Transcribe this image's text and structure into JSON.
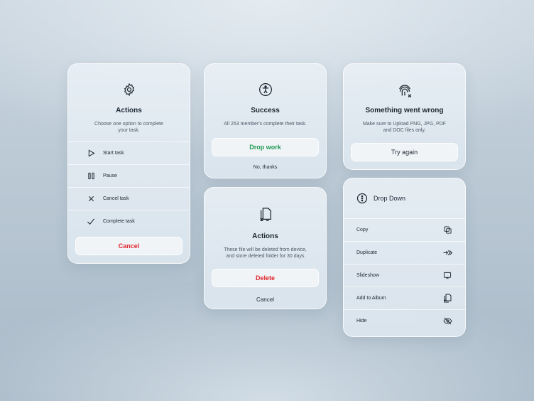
{
  "card_actions": {
    "icon": "gear-icon",
    "title": "Actions",
    "description_line1": "Choose one option to complete",
    "description_line2": "your task.",
    "items": [
      {
        "label": "Start task",
        "icon": "play-icon"
      },
      {
        "label": "Pause",
        "icon": "pause-icon"
      },
      {
        "label": "Cancel task",
        "icon": "x-icon"
      },
      {
        "label": "Complete task",
        "icon": "check-icon"
      }
    ],
    "cancel_label": "Cancel"
  },
  "card_success": {
    "icon": "accessibility-icon",
    "title": "Success",
    "description": "All 253 member's complete their task.",
    "primary_label": "Drop work",
    "secondary_label": "No, thanks"
  },
  "card_error": {
    "icon": "fingerprint-x-icon",
    "title": "Something went wrong",
    "description_line1": "Make sure to Upload PNG, JPG, PDF",
    "description_line2": "and DOC files only.",
    "retry_label": "Try again"
  },
  "card_delete": {
    "icon": "files-x-icon",
    "title": "Actions",
    "description_line1": "These file will be deleted from device,",
    "description_line2": "and store deleted folder for 30 days",
    "delete_label": "Delete",
    "cancel_label": "Cancel"
  },
  "card_dropdown": {
    "icon": "more-vertical-circle-icon",
    "title": "Drop Down",
    "items": [
      {
        "label": "Copy",
        "icon": "copy-icon"
      },
      {
        "label": "Duplicate",
        "icon": "duplicate-arrows-icon"
      },
      {
        "label": "Slideshow",
        "icon": "slideshow-icon"
      },
      {
        "label": "Add to Album",
        "icon": "add-album-icon"
      },
      {
        "label": "Hide",
        "icon": "eye-off-icon"
      }
    ]
  },
  "colors": {
    "danger": "#e0262c",
    "success": "#1f9a55",
    "text": "#1d2731",
    "muted": "#4b5866"
  }
}
